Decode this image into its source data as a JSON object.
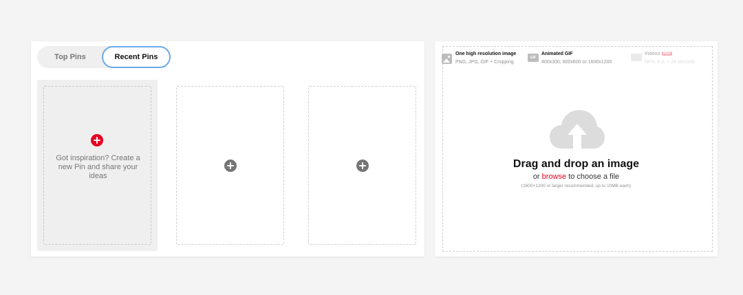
{
  "tabs": [
    {
      "label": "Top Pins",
      "active": false
    },
    {
      "label": "Recent Pins",
      "active": true
    }
  ],
  "create_pin": {
    "prompt": "Got inspiration? Create a new Pin and share your ideas"
  },
  "upload": {
    "formats": [
      {
        "icon": "image-icon",
        "title": "One high resolution image",
        "desc": "PNG, JPG, GIF + Cropping"
      },
      {
        "icon": "gif-icon",
        "icon_text": "GIF",
        "title": "Animated GIF",
        "desc": "400x300, 800x600 or 1600x1200"
      },
      {
        "icon": "video-icon",
        "title": "Videos",
        "badge": "PRO",
        "desc": "MP4, 4:3, < 24 seconds"
      }
    ],
    "drag_title": "Drag and drop an image",
    "or_text": "or",
    "browse_label": "browse",
    "choose_text": "to choose a file",
    "note": "(1600×1200 or larger recommended, up to 10MB each)"
  },
  "colors": {
    "accent_red": "#e60023",
    "tab_focus_ring": "#6aa9e9",
    "cloud_gray": "#dcdcdc"
  }
}
